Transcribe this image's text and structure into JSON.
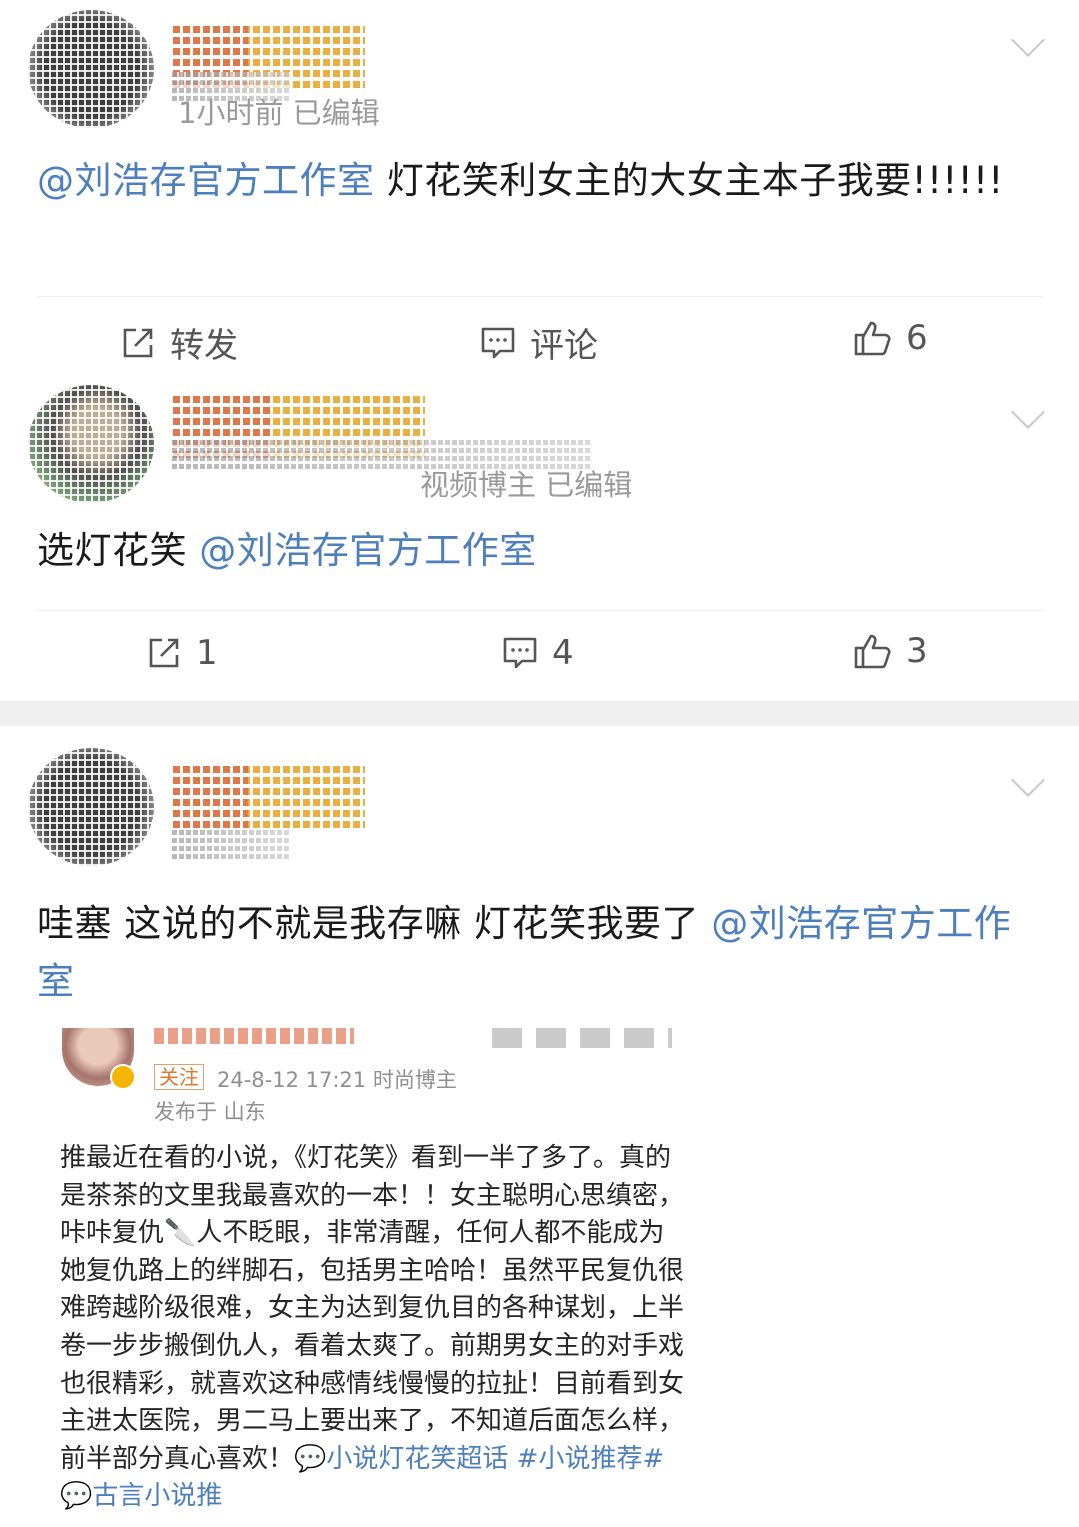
{
  "posts": [
    {
      "meta": "1小时前  已编辑",
      "content_prefix": "",
      "mention": "@刘浩存官方工作室",
      "content_after": " 灯花笑利女主的大女主本子我要!!!!!!",
      "actions": {
        "repost_label": "转发",
        "comment_label": "评论",
        "like_count": "6"
      }
    },
    {
      "meta": "视频博主  已编辑",
      "content_prefix": "选灯花笑 ",
      "mention": "@刘浩存官方工作室",
      "content_after": "",
      "actions": {
        "repost_count": "1",
        "comment_count": "4",
        "like_count": "3"
      }
    },
    {
      "content_prefix": "哇塞 这说的不就是我存嘛 灯花笑我要了 ",
      "mention": "@刘浩存官方工作室",
      "content_after": "",
      "quote": {
        "follow_label": "关注",
        "meta": "24-8-12 17:21  时尚博主",
        "location": "发布于 山东",
        "body": "推最近在看的小说，《灯花笑》看到一半了多了。真的是茶茶的文里我最喜欢的一本！！女主聪明心思缜密，咔咔复仇🔪人不眨眼，非常清醒，任何人都不能成为她复仇路上的绊脚石，包括男主哈哈！虽然平民复仇很难跨越阶级很难，女主为达到复仇目的各种谋划，上半卷一步步搬倒仇人，看着太爽了。前期男女主的对手戏也很精彩，就喜欢这种感情线慢慢的拉扯！目前看到女主进太医院，男二马上要出来了，不知道后面怎么样，前半部分真心喜欢！",
        "tags": "💬小说灯花笑超话 #小说推荐#💬古言小说推"
      }
    }
  ],
  "colors": {
    "mention": "#4e7fbd",
    "text": "#1a1a1a",
    "meta": "#9a9a9a",
    "divider": "#efefef"
  },
  "icons": [
    "repost-icon",
    "comment-icon",
    "like-icon",
    "chevron-down-icon"
  ]
}
